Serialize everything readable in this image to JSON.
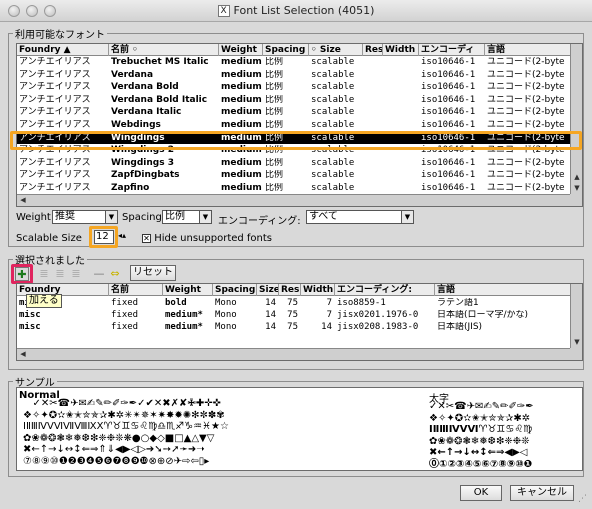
{
  "window": {
    "title": "Font List Selection (4051)"
  },
  "font_list": {
    "group_label": "利用可能なフォント",
    "columns": [
      "Foundry ▲",
      "名前 ◦",
      "Weight",
      "Spacing",
      "◦ Size",
      "Res",
      "Width",
      "エンコーディ",
      "言語"
    ],
    "rows": [
      [
        "アンチエイリアス",
        "Trebuchet MS Italic",
        "medium",
        "比例",
        "scalable",
        "",
        "",
        "iso10646-1",
        "ユニコード(2-byte"
      ],
      [
        "アンチエイリアス",
        "Verdana",
        "medium",
        "比例",
        "scalable",
        "",
        "",
        "iso10646-1",
        "ユニコード(2-byte"
      ],
      [
        "アンチエイリアス",
        "Verdana Bold",
        "medium",
        "比例",
        "scalable",
        "",
        "",
        "iso10646-1",
        "ユニコード(2-byte"
      ],
      [
        "アンチエイリアス",
        "Verdana Bold Italic",
        "medium",
        "比例",
        "scalable",
        "",
        "",
        "iso10646-1",
        "ユニコード(2-byte"
      ],
      [
        "アンチエイリアス",
        "Verdana Italic",
        "medium",
        "比例",
        "scalable",
        "",
        "",
        "iso10646-1",
        "ユニコード(2-byte"
      ],
      [
        "アンチエイリアス",
        "Webdings",
        "medium",
        "比例",
        "scalable",
        "",
        "",
        "iso10646-1",
        "ユニコード(2-byte"
      ],
      [
        "アンチエイリアス",
        "Wingdings",
        "medium",
        "比例",
        "scalable",
        "",
        "",
        "iso10646-1",
        "ユニコード(2-byte"
      ],
      [
        "アンチエイリアス",
        "Wingdings 2",
        "medium",
        "比例",
        "scalable",
        "",
        "",
        "iso10646-1",
        "ユニコード(2-byte"
      ],
      [
        "アンチエイリアス",
        "Wingdings 3",
        "medium",
        "比例",
        "scalable",
        "",
        "",
        "iso10646-1",
        "ユニコード(2-byte"
      ],
      [
        "アンチエイリアス",
        "ZapfDingbats",
        "medium",
        "比例",
        "scalable",
        "",
        "",
        "iso10646-1",
        "ユニコード(2-byte"
      ],
      [
        "アンチエイリアス",
        "Zapfino",
        "medium",
        "比例",
        "scalable",
        "",
        "",
        "iso10646-1",
        "ユニコード(2-byte"
      ]
    ],
    "selected_index": 6
  },
  "filters": {
    "weight_label": "Weight",
    "weight_value": "推奨",
    "spacing_label": "Spacing",
    "spacing_value": "比例",
    "encoding_label": "エンコーディング:",
    "encoding_value": "すべて",
    "scalable_label": "Scalable Size",
    "scalable_value": "12",
    "hide_label": "Hide unsupported fonts",
    "hide_checked": true
  },
  "selected": {
    "group_label": "選択されました",
    "reset_label": "リセット",
    "add_tooltip": "加える",
    "columns": [
      "Foundry",
      "名前",
      "Weight",
      "Spacing",
      "Size",
      "Res",
      "Width",
      "エンコーディング:",
      "言語"
    ],
    "rows": [
      [
        "misc",
        "fixed",
        "bold",
        "Mono",
        "14",
        "75",
        "7",
        "iso8859-1",
        "ラテン語1"
      ],
      [
        "misc",
        "fixed",
        "medium*",
        "Mono",
        "14",
        "75",
        "7",
        "jisx0201.1976-0",
        "日本語(ローマ字/かな)"
      ],
      [
        "misc",
        "fixed",
        "medium*",
        "Mono",
        "14",
        "75",
        "14",
        "jisx0208.1983-0",
        "日本語(JIS)"
      ]
    ]
  },
  "sample": {
    "group_label": "サンプル",
    "normal_label": "Normal",
    "bold_label": "太字",
    "normal_lines": [
      "   ✓✕✂☎✈✉✍✎✏✐✑✒✓✔✕✖✗✘✙✚✛✜",
      "❖✧✦✪✫✬✭✮✯✰✱✲✳✴✵✶✷✸✹✺✻✼✽✾",
      "ⅠⅡⅢⅣⅤⅥⅦⅧⅨⅩ♈♉♊♋♌♍♎♏♐♑♒♓★☆",
      "✿❀❁❂❃❄❅❆❇❈❉❊❋●○◆◇■□▲△▼▽",
      "✖←↑→↓↔↕⇐⇒⇑⇓◀▶◁▷➔➘➙➚➛➜➝",
      "⑦⑧⑨⑩❶❷❸❹❺❻❼❽❾❿⊗⊕⊘✈⇨⇦▯▸"
    ],
    "bold_lines": [
      "✓✕✂☎✈✉✍✎✏✐✑✒",
      "❖✧✦✪✫✬✭✮✯✰✱✲",
      "ⅠⅡⅢⅣⅤⅥ♈♉♊♋♌♍",
      "✿❀❁❂❃❄❅❆❇❈❉❊",
      "✖←↑→↓↔↕⇐⇒◀▶◁",
      "⓪①②③④⑤⑥⑦⑧⑨⑩❶"
    ]
  },
  "buttons": {
    "ok": "OK",
    "cancel": "キャンセル"
  },
  "colors": {
    "highlight": "#f5a623",
    "add_highlight": "#e0245e",
    "selection": "#000000"
  }
}
